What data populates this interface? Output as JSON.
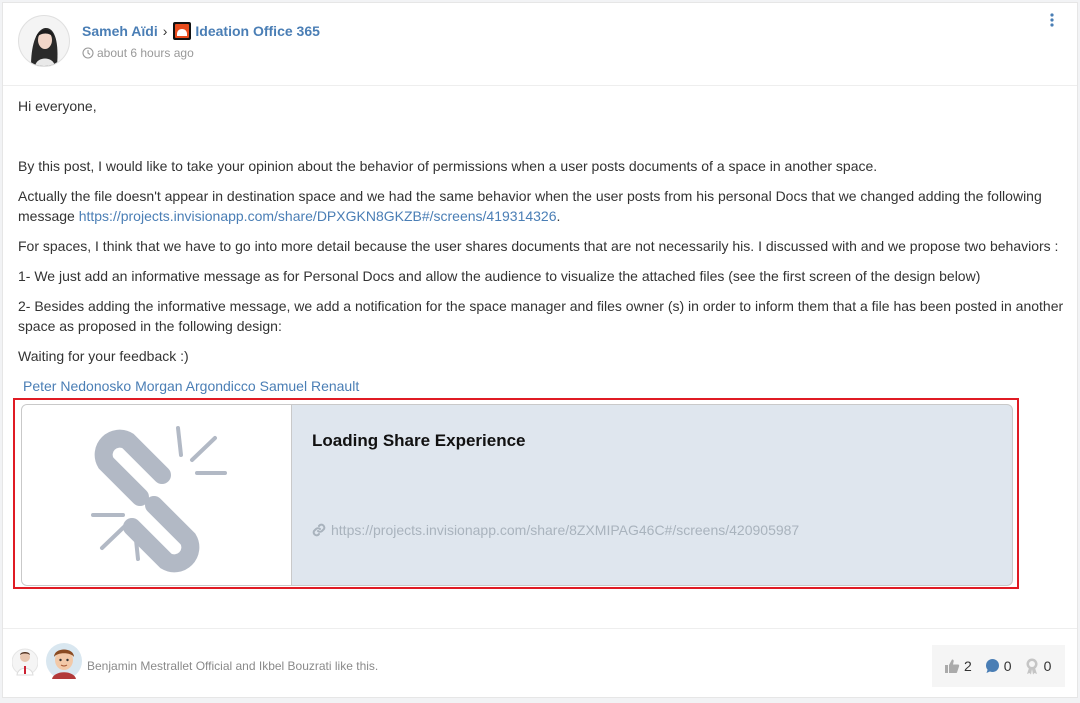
{
  "post": {
    "author": "Sameh Aïdi",
    "separator": "›",
    "space": "Ideation Office 365",
    "time": "about 6 hours ago"
  },
  "body": {
    "greeting": "Hi everyone,",
    "p1": "By this post, I would like to take your opinion about the behavior of permissions when a user posts documents of a space in another space.",
    "p2_text": "Actually the file doesn't appear in destination space and we had the same behavior when the user posts from his personal Docs that we changed adding the following message ",
    "p2_link": "https://projects.invisionapp.com/share/DPXGKN8GKZB#/screens/419314326",
    "p2_end": ".",
    "p3": "For spaces, I think that we have to go into more detail because the user shares documents that are not necessarily his. I discussed with and we propose two behaviors :",
    "p4": "1- We just add an informative message as for Personal Docs and allow the audience to visualize the attached files (see the first screen of the design below)",
    "p5": "2- Besides adding the informative message, we add a notification for the space manager and files owner (s) in order to inform them that a file has been posted in another space as proposed in the following design:",
    "p6": "Waiting for your feedback :)",
    "mentions": [
      "Peter Nedonosko",
      "Morgan Argondicco",
      "Samuel Renault"
    ]
  },
  "share": {
    "title": "Loading Share Experience",
    "url": "https://projects.invisionapp.com/share/8ZXMIPAG46C#/screens/420905987"
  },
  "footer": {
    "likes_text": "Benjamin Mestrallet Official and Ikbel Bouzrati like this.",
    "like_count": "2",
    "comment_count": "0",
    "kudos_count": "0"
  },
  "icons": [
    "clock-icon",
    "menu-dots-icon",
    "broken-link-icon",
    "link-icon",
    "thumbs-up-icon",
    "comment-icon",
    "kudos-icon"
  ],
  "colors": {
    "link": "#4a7eb5",
    "highlight_border": "#e01b24",
    "share_bg": "#dfe6ee",
    "muted": "#999999"
  }
}
